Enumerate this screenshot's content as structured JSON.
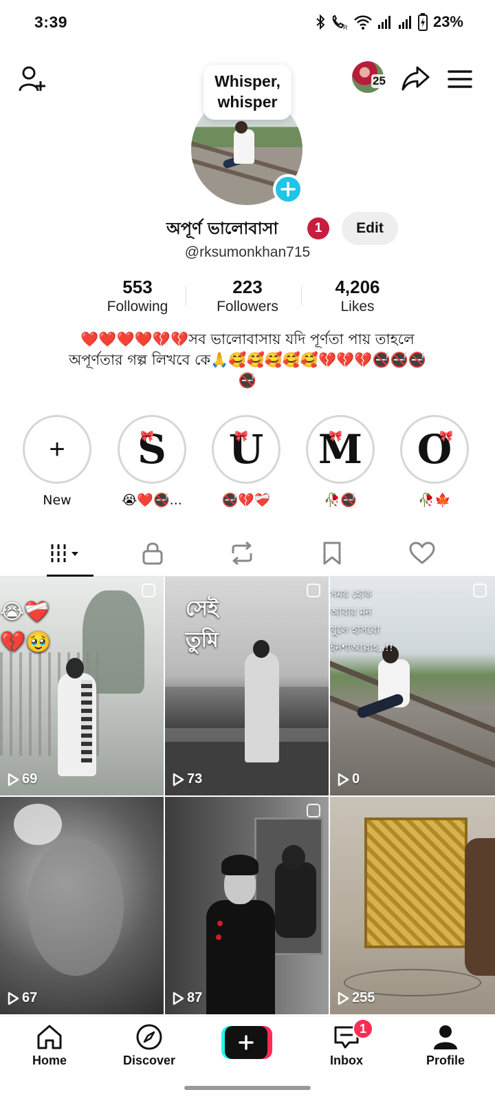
{
  "status_bar": {
    "time": "3:39",
    "battery": "23%",
    "icons": [
      "bluetooth-icon",
      "wifi-calling-icon",
      "wifi-icon",
      "signal-icon",
      "signal-icon",
      "battery-charging-icon"
    ]
  },
  "topbar": {
    "story_count": "25",
    "icons": [
      "add-friend-icon",
      "share-icon",
      "menu-icon"
    ]
  },
  "profile": {
    "bubble_text_line1": "Whisper,",
    "bubble_text_line2": "whisper",
    "display_name": "অপূর্ণ ভালোবাসা",
    "name_badge": "1",
    "edit_label": "Edit",
    "username": "@rksumonkhan715"
  },
  "stats": [
    {
      "value": "553",
      "label": "Following"
    },
    {
      "value": "223",
      "label": "Followers"
    },
    {
      "value": "4,206",
      "label": "Likes"
    }
  ],
  "bio": {
    "line1": "❤️❤️❤️❤️💔💔সব ভালোবাসায় যদি পূর্ণতা পায় তাহলে",
    "line2": "অপূর্ণতার গল্প লিখবে কে🙏🥰🥰🥰🥰🥰💔💔💔🚭🚭🚭",
    "line3": "🚭"
  },
  "highlights": [
    {
      "letter": "+",
      "caption": "New"
    },
    {
      "letter": "S",
      "caption": "😭❤️🚭..."
    },
    {
      "letter": "U",
      "caption": "🚭💔❤️‍🩹"
    },
    {
      "letter": "M",
      "caption": "🥀🚭"
    },
    {
      "letter": "O",
      "caption": "🥀🍁"
    }
  ],
  "tabs": [
    "videos-grid-icon",
    "lock-icon",
    "repost-icon",
    "bookmark-icon",
    "heart-icon"
  ],
  "videos": [
    {
      "views": "69",
      "overlay": "😭❤️‍🩹\n💔🥹"
    },
    {
      "views": "73",
      "overlay": "সেই\nতুমি"
    },
    {
      "views": "0",
      "overlay": "সময় হোক\nআবার মন\nখুলে হাসবো\nইনশাআল্লাহ..!!"
    },
    {
      "views": "67",
      "overlay": ""
    },
    {
      "views": "87",
      "overlay": ""
    },
    {
      "views": "255",
      "overlay": ""
    }
  ],
  "nav": {
    "home": "Home",
    "discover": "Discover",
    "inbox": "Inbox",
    "inbox_badge": "1",
    "profile": "Profile"
  },
  "colors": {
    "accent_cyan": "#20c4e8",
    "badge_red": "#c81d3e",
    "tiktok_pink": "#fe2c55",
    "tiktok_cyan": "#25f4ee"
  }
}
